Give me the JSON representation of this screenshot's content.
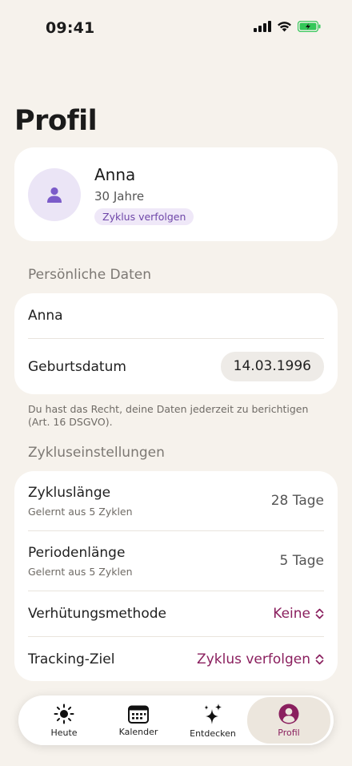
{
  "status": {
    "time": "09:41"
  },
  "title": "Profil",
  "profile": {
    "name": "Anna",
    "age": "30 Jahre",
    "badge": "Zyklus verfolgen"
  },
  "personal": {
    "header": "Persönliche Daten",
    "name_value": "Anna",
    "birthdate_label": "Geburtsdatum",
    "birthdate_value": "14.03.1996",
    "footnote": "Du hast das Recht, deine Daten jederzeit zu berichtigen (Art. 16 DSGVO)."
  },
  "cycle": {
    "header": "Zykluseinstellungen",
    "rows": [
      {
        "label": "Zykluslänge",
        "sub": "Gelernt aus 5 Zyklen",
        "value": "28 Tage"
      },
      {
        "label": "Periodenlänge",
        "sub": "Gelernt aus 5 Zyklen",
        "value": "5 Tage"
      },
      {
        "label": "Verhütungsmethode",
        "value": "Keine"
      },
      {
        "label": "Tracking-Ziel",
        "value": "Zyklus verfolgen"
      }
    ]
  },
  "tabs": [
    {
      "label": "Heute",
      "icon": "sun-icon"
    },
    {
      "label": "Kalender",
      "icon": "calendar-icon"
    },
    {
      "label": "Entdecken",
      "icon": "sparkles-icon"
    },
    {
      "label": "Profil",
      "icon": "person-icon",
      "active": true
    }
  ],
  "colors": {
    "background": "#f6f2ec",
    "accent": "#8a1f5e",
    "avatar_bg": "#ebe5f6",
    "avatar_icon": "#7b5bc9",
    "battery": "#33c759"
  }
}
